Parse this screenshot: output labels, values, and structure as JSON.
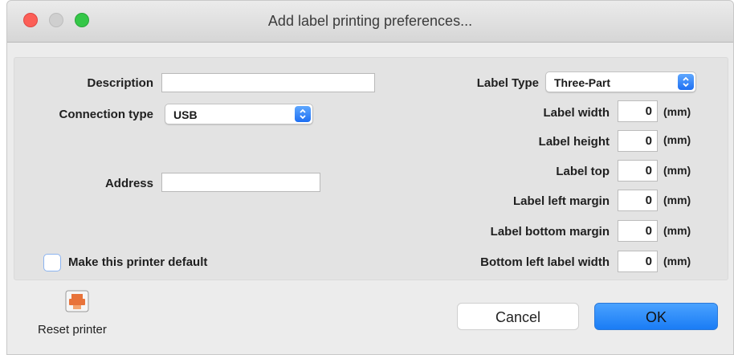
{
  "window": {
    "title": "Add label printing preferences..."
  },
  "form": {
    "description": {
      "label": "Description",
      "value": ""
    },
    "connection_type": {
      "label": "Connection type",
      "selected": "USB"
    },
    "address": {
      "label": "Address",
      "value": ""
    },
    "make_default": {
      "label": "Make this printer default",
      "checked": false
    },
    "label_type": {
      "label": "Label Type",
      "selected": "Three-Part"
    },
    "dimensions": [
      {
        "label": "Label width",
        "value": "0",
        "unit": "(mm)"
      },
      {
        "label": "Label height",
        "value": "0",
        "unit": "(mm)"
      },
      {
        "label": "Label top",
        "value": "0",
        "unit": "(mm)"
      },
      {
        "label": "Label left margin",
        "value": "0",
        "unit": "(mm)"
      },
      {
        "label": "Label bottom margin",
        "value": "0",
        "unit": "(mm)"
      },
      {
        "label": "Bottom left label width",
        "value": "0",
        "unit": "(mm)"
      }
    ]
  },
  "footer": {
    "reset_label": "Reset printer",
    "cancel_label": "Cancel",
    "ok_label": "OK"
  },
  "colors": {
    "accent": "#1a7cf5",
    "close": "#fc5f57",
    "maximize": "#35c748",
    "reset_icon": "#e8733a"
  }
}
